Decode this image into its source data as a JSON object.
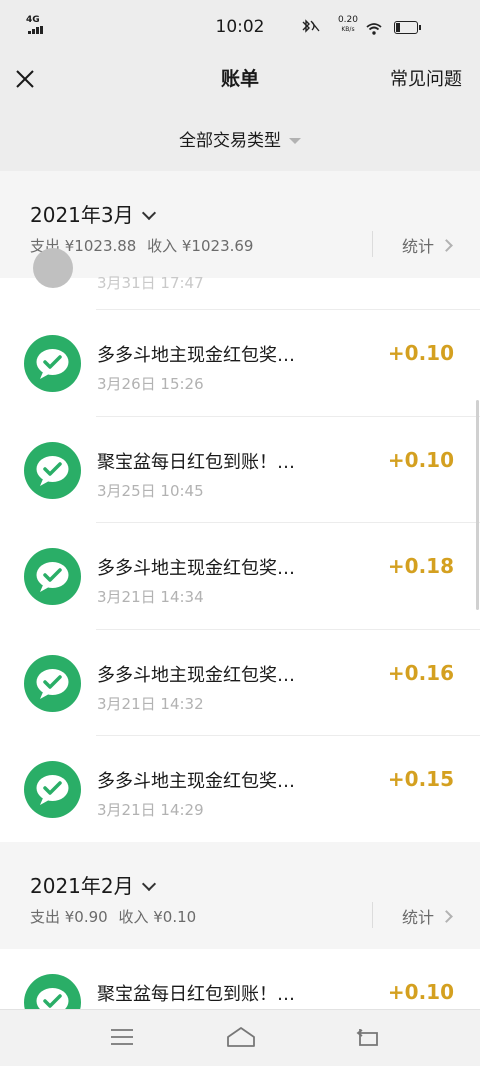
{
  "status_bar": {
    "network": "4G",
    "time": "10:02",
    "speed_value": "0.20",
    "speed_unit": "KB/s"
  },
  "title_bar": {
    "title": "账单",
    "faq_label": "常见问题"
  },
  "filter": {
    "label": "全部交易类型"
  },
  "months": [
    {
      "title": "2021年3月",
      "expense": "支出 ¥1023.88",
      "income": "收入 ¥1023.69",
      "stats_label": "统计",
      "partial_time": "3月31日 17:47",
      "transactions": [
        {
          "name": "多多斗地主现金红包奖…",
          "time": "3月26日 15:26",
          "amount": "+0.10"
        },
        {
          "name": "聚宝盆每日红包到账！…",
          "time": "3月25日 10:45",
          "amount": "+0.10"
        },
        {
          "name": "多多斗地主现金红包奖…",
          "time": "3月21日 14:34",
          "amount": "+0.18"
        },
        {
          "name": "多多斗地主现金红包奖…",
          "time": "3月21日 14:32",
          "amount": "+0.16"
        },
        {
          "name": "多多斗地主现金红包奖…",
          "time": "3月21日 14:29",
          "amount": "+0.15"
        }
      ]
    },
    {
      "title": "2021年2月",
      "expense": "支出 ¥0.90",
      "income": "收入 ¥0.10",
      "stats_label": "统计",
      "transactions": [
        {
          "name": "聚宝盆每日红包到账！…",
          "time": "",
          "amount": "+0.10"
        }
      ]
    }
  ],
  "colors": {
    "amount": "#d4a020",
    "wechat_green": "#2aae67"
  },
  "icons": [
    "close-icon",
    "chevron-down-icon",
    "chevron-right-icon",
    "wechat-pay-icon",
    "menu-icon",
    "home-icon",
    "back-icon"
  ]
}
